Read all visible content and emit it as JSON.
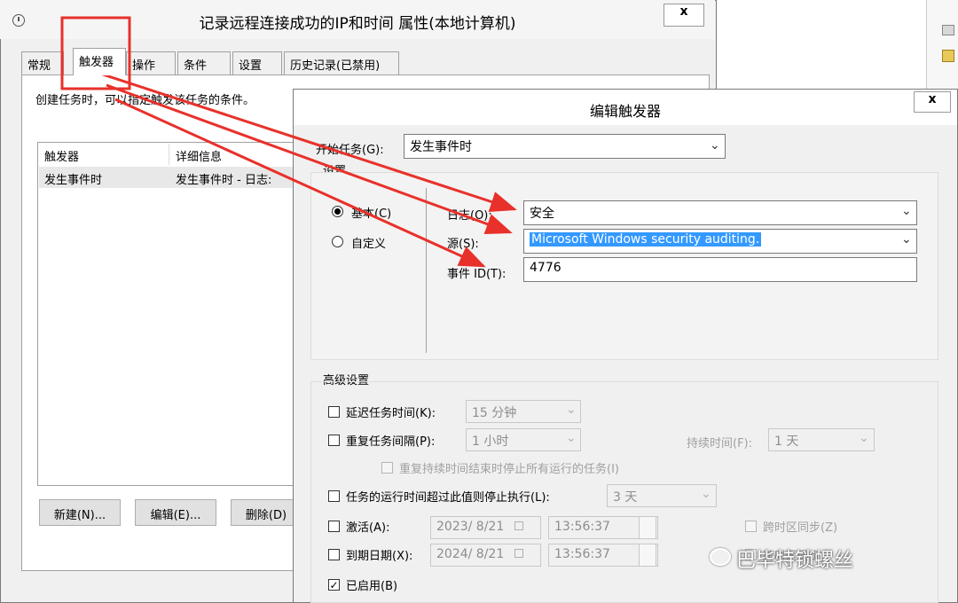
{
  "bg_window": {
    "title": "记录远程连接成功的IP和时间 属性(本地计算机)",
    "close": "x",
    "tabs": [
      "常规",
      "触发器",
      "操作",
      "条件",
      "设置",
      "历史记录(已禁用)"
    ],
    "description": "创建任务时，可以指定触发该任务的条件。",
    "list_headers": [
      "触发器",
      "详细信息"
    ],
    "list_row": [
      "发生事件时",
      "发生事件时 - 日志:"
    ],
    "buttons": [
      "新建(N)...",
      "编辑(E)...",
      "删除(D)"
    ]
  },
  "dialog": {
    "title": "编辑触发器",
    "close": "x",
    "begin_task_label": "开始任务(G):",
    "begin_task_value": "发生事件时",
    "settings_label": "设置",
    "radio_basic": "基本(C)",
    "radio_custom": "自定义",
    "log_label": "日志(O):",
    "log_value": "安全",
    "source_label": "源(S):",
    "source_value": "Microsoft Windows security auditing.",
    "event_id_label": "事件 ID(T):",
    "event_id_value": "4776",
    "advanced_label": "高级设置",
    "delay_label": "延迟任务时间(K):",
    "delay_value": "15 分钟",
    "repeat_label": "重复任务间隔(P):",
    "repeat_value": "1 小时",
    "duration_label": "持续时间(F):",
    "duration_value": "1 天",
    "stop_all_label": "重复持续时间结束时停止所有运行的任务(I)",
    "stop_if_label": "任务的运行时间超过此值则停止执行(L):",
    "stop_if_value": "3 天",
    "activate_label": "激活(A):",
    "activate_date": "2023/ 8/21",
    "activate_time": "13:56:37",
    "sync_tz_label": "跨时区同步(Z)",
    "expire_label": "到期日期(X):",
    "expire_date": "2024/ 8/21",
    "expire_time": "13:56:37",
    "expire_sync_partial": "跨时区同步",
    "enabled_label": "已启用(B)"
  },
  "watermark": "巴毕特锁螺丝",
  "colors": {
    "annotation_red": "#e8312a",
    "selection_blue": "#3399ff"
  }
}
